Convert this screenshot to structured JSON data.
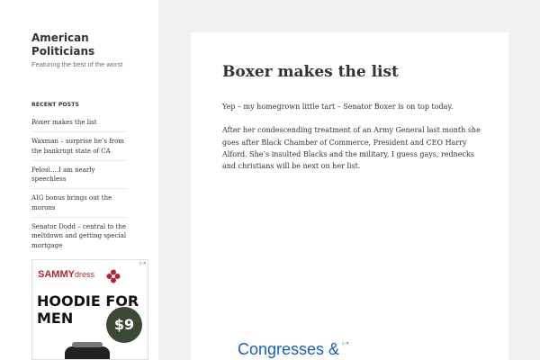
{
  "site": {
    "title": "American Politicians",
    "description": "Featuring the best of the worst"
  },
  "sidebar": {
    "widget_title": "RECENT POSTS",
    "recent_posts": [
      "Boxer makes the list",
      "Waxman – surprise he’s from the bankrupt state of CA",
      "Pelosi….I am nearly speechless",
      "AIG bonus brings out the morons",
      "Senator Dodd – central to the meltdown and getting special mortgage"
    ],
    "ad": {
      "brand": "SAMMY",
      "brand_suffix": "dress",
      "headline": "HOODIE FOR MEN",
      "price": "$9",
      "brand_color": "#b8242c"
    }
  },
  "post": {
    "title": "Boxer makes the list",
    "paragraphs": [
      "Yep – my homegrown little tart – Senator Boxer is on top today.",
      "After her condescending treatment of an Army General last month she goes after Black Chamber of Commerce, President and CEO Harry Alford. She’s insulted Blacks and the military, I guess gays, rednecks and christians will be next on her list."
    ],
    "ad_text": "Congresses &"
  }
}
